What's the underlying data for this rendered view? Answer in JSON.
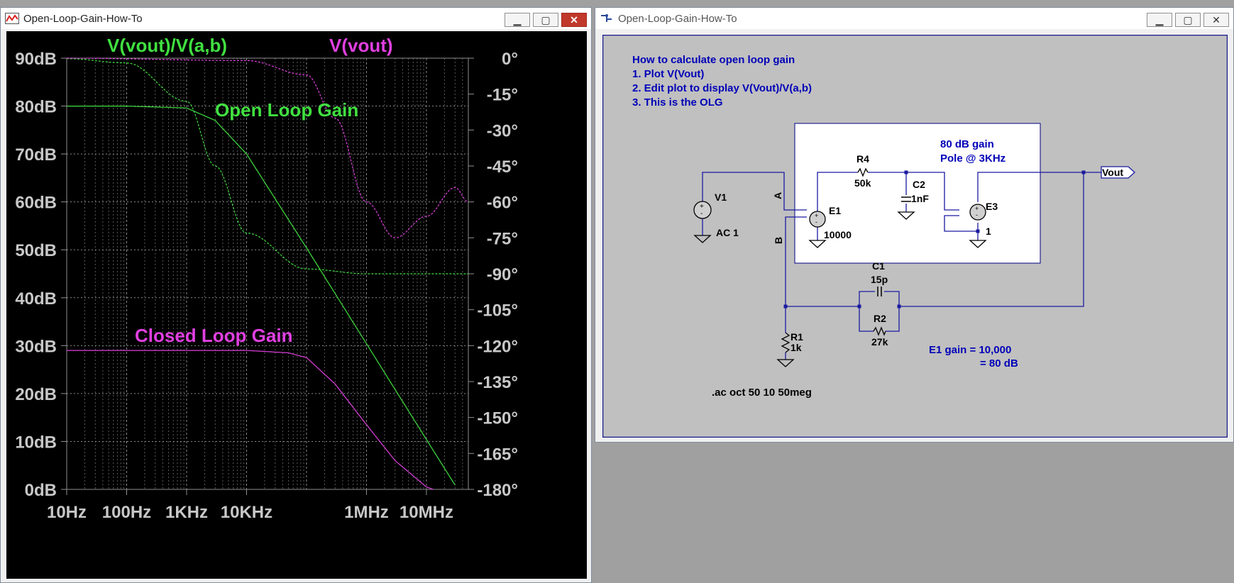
{
  "plot_window": {
    "title": "Open-Loop-Gain-How-To",
    "buttons": {
      "minimize": "▁",
      "maximize": "▢",
      "close": "✕"
    }
  },
  "schematic_window": {
    "title": "Open-Loop-Gain-How-To",
    "buttons": {
      "minimize": "▁",
      "maximize": "▢",
      "close": "✕"
    }
  },
  "chart_data": {
    "type": "line",
    "x_scale": "log",
    "xlim": [
      10,
      50000000
    ],
    "ylim_left": [
      0,
      90
    ],
    "ylim_right": [
      -180,
      0
    ],
    "grid": true,
    "trace_labels": [
      "V(vout)/V(a,b)",
      "V(vout)"
    ],
    "annotations": [
      "Open Loop Gain",
      "Closed Loop Gain"
    ],
    "x_tick_labels": [
      "10Hz",
      "100Hz",
      "1KHz",
      "10KHz",
      "1MHz",
      "10MHz"
    ],
    "y_left_tick_labels": [
      "90dB",
      "80dB",
      "70dB",
      "60dB",
      "50dB",
      "40dB",
      "30dB",
      "20dB",
      "10dB",
      "0dB"
    ],
    "y_right_tick_labels": [
      "0°",
      "-15°",
      "-30°",
      "-45°",
      "-60°",
      "-75°",
      "-90°",
      "-105°",
      "-120°",
      "-135°",
      "-150°",
      "-165°",
      "-180°"
    ],
    "series": [
      {
        "name": "V(vout)/V(a,b)",
        "quantity": "magnitude",
        "color": "#40e040",
        "x": [
          10,
          100,
          1000,
          3000,
          10000,
          100000,
          1000000,
          10000000,
          30000000
        ],
        "y": [
          80,
          80,
          79.6,
          77,
          70,
          50.4,
          30.4,
          10.4,
          0.9
        ]
      },
      {
        "name": "V(vout)/V(a,b)",
        "quantity": "phase",
        "color": "#40e040",
        "x": [
          10,
          100,
          1000,
          3000,
          10000,
          100000,
          1000000,
          50000000
        ],
        "y": [
          -0.2,
          -2,
          -18,
          -45,
          -73,
          -88,
          -90,
          -90
        ]
      },
      {
        "name": "V(vout)",
        "quantity": "magnitude",
        "color": "#e040e0",
        "x": [
          10,
          10000,
          50000,
          100000,
          300000,
          1000000,
          3000000,
          10000000,
          13000000
        ],
        "y": [
          29,
          29,
          28.5,
          27.5,
          22,
          13.5,
          6,
          0.5,
          0
        ]
      },
      {
        "name": "V(vout)",
        "quantity": "phase",
        "color": "#e040e0",
        "x": [
          10,
          10000,
          100000,
          300000,
          1000000,
          3000000,
          10000000,
          30000000,
          50000000
        ],
        "y": [
          0,
          -1,
          -7,
          -25,
          -60,
          -75,
          -66,
          -54,
          -60
        ]
      }
    ]
  },
  "schematic": {
    "instructions": [
      "How to calculate open loop gain",
      "1.  Plot V(Vout)",
      "2.  Edit plot to display  V(Vout)/V(a,b)",
      "3.  This is the OLG"
    ],
    "box_note": [
      "80 dB gain",
      "Pole @ 3KHz"
    ],
    "components": {
      "R4": {
        "ref": "R4",
        "value": "50k"
      },
      "C2": {
        "ref": "C2",
        "value": "1nF"
      },
      "E1": {
        "ref": "E1",
        "value": "10000"
      },
      "E3": {
        "ref": "E3",
        "value": "1"
      },
      "V1": {
        "ref": "V1",
        "value": "AC 1"
      },
      "C1": {
        "ref": "C1",
        "value": "15p"
      },
      "R2": {
        "ref": "R2",
        "value": "27k"
      },
      "R1": {
        "ref": "R1",
        "value": "1k"
      }
    },
    "nets": {
      "a": "A",
      "b": "B",
      "out": "Vout"
    },
    "gain_note": [
      "E1 gain = 10,000",
      "= 80 dB"
    ],
    "directive": ".ac oct 50 10 50meg"
  }
}
